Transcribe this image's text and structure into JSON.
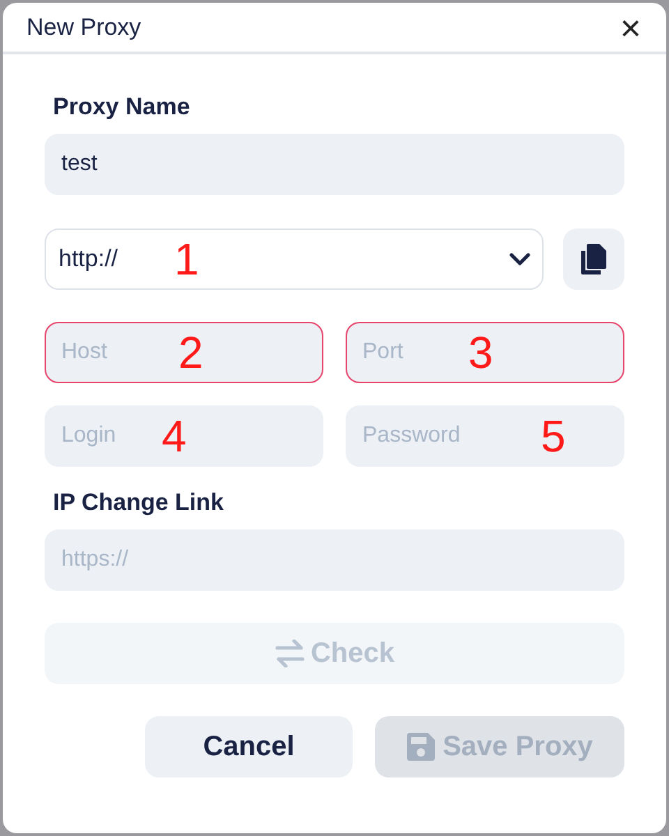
{
  "window": {
    "title": "New Proxy",
    "close": "×"
  },
  "name_field": {
    "label": "Proxy Name",
    "value": "test"
  },
  "protocol_select": {
    "value": "http://",
    "annotation": "1"
  },
  "fields": [
    {
      "placeholder": "Host",
      "invalid": true,
      "annotation": "2"
    },
    {
      "placeholder": "Port",
      "invalid": true,
      "annotation": "3"
    },
    {
      "placeholder": "Login",
      "invalid": false,
      "annotation": "4"
    },
    {
      "placeholder": "Password",
      "invalid": false,
      "annotation": "5"
    }
  ],
  "ip_change": {
    "label": "IP Change Link",
    "placeholder": "https://"
  },
  "check_button": {
    "label": "Check",
    "disabled": true
  },
  "buttons": [
    {
      "label": "Cancel",
      "kind": "cancel",
      "disabled": false
    },
    {
      "label": "Save Proxy",
      "kind": "save",
      "disabled": true
    }
  ]
}
